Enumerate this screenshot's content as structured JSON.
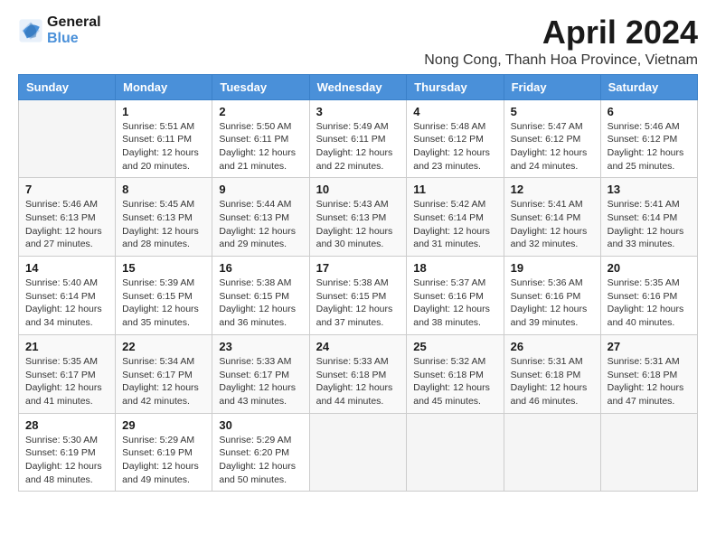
{
  "header": {
    "logo_line1": "General",
    "logo_line2": "Blue",
    "title": "April 2024",
    "subtitle": "Nong Cong, Thanh Hoa Province, Vietnam"
  },
  "days_of_week": [
    "Sunday",
    "Monday",
    "Tuesday",
    "Wednesday",
    "Thursday",
    "Friday",
    "Saturday"
  ],
  "weeks": [
    [
      {
        "day": "",
        "info": ""
      },
      {
        "day": "1",
        "info": "Sunrise: 5:51 AM\nSunset: 6:11 PM\nDaylight: 12 hours\nand 20 minutes."
      },
      {
        "day": "2",
        "info": "Sunrise: 5:50 AM\nSunset: 6:11 PM\nDaylight: 12 hours\nand 21 minutes."
      },
      {
        "day": "3",
        "info": "Sunrise: 5:49 AM\nSunset: 6:11 PM\nDaylight: 12 hours\nand 22 minutes."
      },
      {
        "day": "4",
        "info": "Sunrise: 5:48 AM\nSunset: 6:12 PM\nDaylight: 12 hours\nand 23 minutes."
      },
      {
        "day": "5",
        "info": "Sunrise: 5:47 AM\nSunset: 6:12 PM\nDaylight: 12 hours\nand 24 minutes."
      },
      {
        "day": "6",
        "info": "Sunrise: 5:46 AM\nSunset: 6:12 PM\nDaylight: 12 hours\nand 25 minutes."
      }
    ],
    [
      {
        "day": "7",
        "info": "Sunrise: 5:46 AM\nSunset: 6:13 PM\nDaylight: 12 hours\nand 27 minutes."
      },
      {
        "day": "8",
        "info": "Sunrise: 5:45 AM\nSunset: 6:13 PM\nDaylight: 12 hours\nand 28 minutes."
      },
      {
        "day": "9",
        "info": "Sunrise: 5:44 AM\nSunset: 6:13 PM\nDaylight: 12 hours\nand 29 minutes."
      },
      {
        "day": "10",
        "info": "Sunrise: 5:43 AM\nSunset: 6:13 PM\nDaylight: 12 hours\nand 30 minutes."
      },
      {
        "day": "11",
        "info": "Sunrise: 5:42 AM\nSunset: 6:14 PM\nDaylight: 12 hours\nand 31 minutes."
      },
      {
        "day": "12",
        "info": "Sunrise: 5:41 AM\nSunset: 6:14 PM\nDaylight: 12 hours\nand 32 minutes."
      },
      {
        "day": "13",
        "info": "Sunrise: 5:41 AM\nSunset: 6:14 PM\nDaylight: 12 hours\nand 33 minutes."
      }
    ],
    [
      {
        "day": "14",
        "info": "Sunrise: 5:40 AM\nSunset: 6:14 PM\nDaylight: 12 hours\nand 34 minutes."
      },
      {
        "day": "15",
        "info": "Sunrise: 5:39 AM\nSunset: 6:15 PM\nDaylight: 12 hours\nand 35 minutes."
      },
      {
        "day": "16",
        "info": "Sunrise: 5:38 AM\nSunset: 6:15 PM\nDaylight: 12 hours\nand 36 minutes."
      },
      {
        "day": "17",
        "info": "Sunrise: 5:38 AM\nSunset: 6:15 PM\nDaylight: 12 hours\nand 37 minutes."
      },
      {
        "day": "18",
        "info": "Sunrise: 5:37 AM\nSunset: 6:16 PM\nDaylight: 12 hours\nand 38 minutes."
      },
      {
        "day": "19",
        "info": "Sunrise: 5:36 AM\nSunset: 6:16 PM\nDaylight: 12 hours\nand 39 minutes."
      },
      {
        "day": "20",
        "info": "Sunrise: 5:35 AM\nSunset: 6:16 PM\nDaylight: 12 hours\nand 40 minutes."
      }
    ],
    [
      {
        "day": "21",
        "info": "Sunrise: 5:35 AM\nSunset: 6:17 PM\nDaylight: 12 hours\nand 41 minutes."
      },
      {
        "day": "22",
        "info": "Sunrise: 5:34 AM\nSunset: 6:17 PM\nDaylight: 12 hours\nand 42 minutes."
      },
      {
        "day": "23",
        "info": "Sunrise: 5:33 AM\nSunset: 6:17 PM\nDaylight: 12 hours\nand 43 minutes."
      },
      {
        "day": "24",
        "info": "Sunrise: 5:33 AM\nSunset: 6:18 PM\nDaylight: 12 hours\nand 44 minutes."
      },
      {
        "day": "25",
        "info": "Sunrise: 5:32 AM\nSunset: 6:18 PM\nDaylight: 12 hours\nand 45 minutes."
      },
      {
        "day": "26",
        "info": "Sunrise: 5:31 AM\nSunset: 6:18 PM\nDaylight: 12 hours\nand 46 minutes."
      },
      {
        "day": "27",
        "info": "Sunrise: 5:31 AM\nSunset: 6:18 PM\nDaylight: 12 hours\nand 47 minutes."
      }
    ],
    [
      {
        "day": "28",
        "info": "Sunrise: 5:30 AM\nSunset: 6:19 PM\nDaylight: 12 hours\nand 48 minutes."
      },
      {
        "day": "29",
        "info": "Sunrise: 5:29 AM\nSunset: 6:19 PM\nDaylight: 12 hours\nand 49 minutes."
      },
      {
        "day": "30",
        "info": "Sunrise: 5:29 AM\nSunset: 6:20 PM\nDaylight: 12 hours\nand 50 minutes."
      },
      {
        "day": "",
        "info": ""
      },
      {
        "day": "",
        "info": ""
      },
      {
        "day": "",
        "info": ""
      },
      {
        "day": "",
        "info": ""
      }
    ]
  ]
}
